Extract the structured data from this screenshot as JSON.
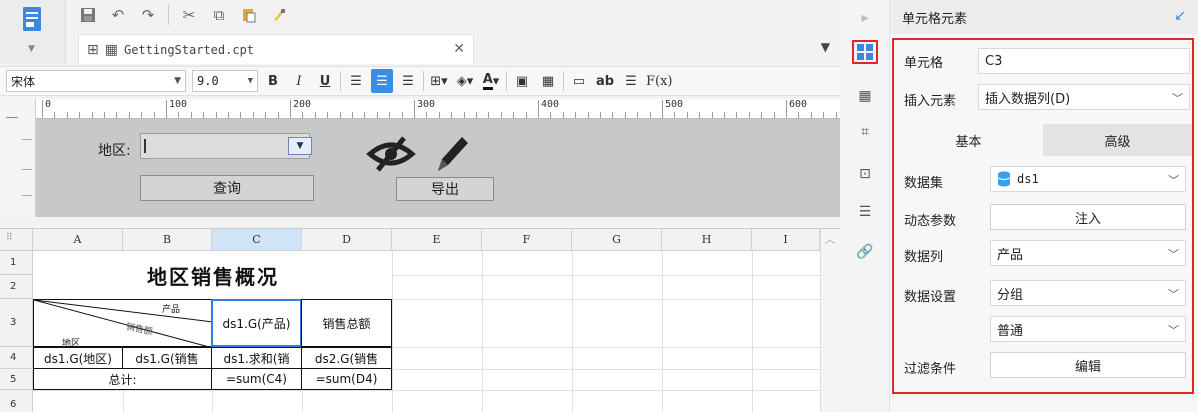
{
  "toolbar": {
    "icons": [
      "save-icon",
      "undo-icon",
      "redo-icon",
      "cut-icon",
      "copy-icon",
      "paste-icon",
      "format-painter-icon"
    ]
  },
  "tab": {
    "title": "GettingStarted.cpt"
  },
  "format": {
    "font": "宋体",
    "size": "9.0",
    "bold": "B",
    "italic": "I",
    "underline": "U",
    "ab": "ab",
    "formula": "F(x)"
  },
  "ruler": {
    "labels": [
      "0",
      "100",
      "200",
      "300",
      "400",
      "500",
      "600"
    ]
  },
  "param_panel": {
    "region_label": "地区:",
    "query_button": "查询",
    "export_button": "导出"
  },
  "grid": {
    "columns": [
      "A",
      "B",
      "C",
      "D",
      "E",
      "F",
      "G",
      "H",
      "I"
    ],
    "rows": [
      "1",
      "2",
      "3",
      "4",
      "5",
      "6"
    ],
    "title": "地区销售概况",
    "diag_top": "产品",
    "diag_mid": "销售额",
    "diag_bottom": "地区",
    "c3": "ds1.G(产品)",
    "d3": "销售总额",
    "a4": "ds1.G(地区)",
    "b4": "ds1.G(销售",
    "c4": "ds1.求和(销",
    "d4": "ds2.G(销售",
    "total_label": "总计:",
    "c5": "=sum(C4)",
    "d5": "=sum(D4)"
  },
  "panel": {
    "header": "单元格元素",
    "cell_label": "单元格",
    "cell_value": "C3",
    "insert_label": "插入元素",
    "insert_value": "插入数据列(D)",
    "tab_basic": "基本",
    "tab_advanced": "高级",
    "dataset_label": "数据集",
    "dataset_value": "ds1",
    "dynamic_label": "动态参数",
    "dynamic_button": "注入",
    "column_label": "数据列",
    "column_value": "产品",
    "setting_label": "数据设置",
    "setting_value": "分组",
    "setting_value2": "普通",
    "filter_label": "过滤条件",
    "filter_button": "编辑"
  },
  "colors": {
    "accent": "#3b8ee8",
    "highlight_border": "#e0262c"
  }
}
